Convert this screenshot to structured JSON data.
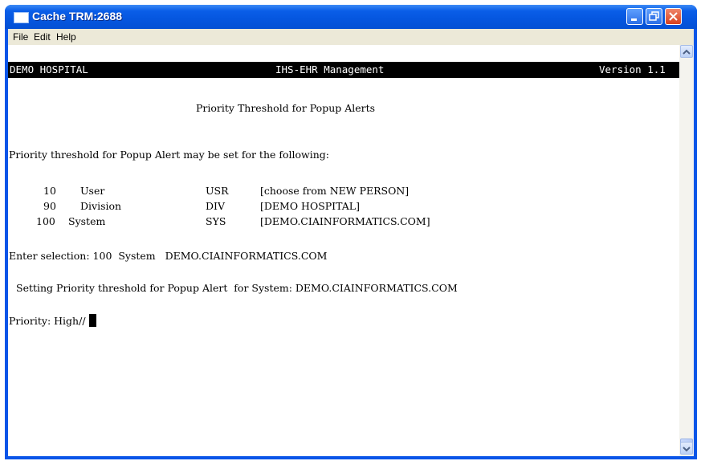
{
  "window": {
    "title": "Cache TRM:2688"
  },
  "menu": [
    "File",
    "Edit",
    "Help"
  ],
  "status_bar": {
    "left": "DEMO HOSPITAL",
    "center": "IHS-EHR Management",
    "right": "Version 1.1"
  },
  "screen": {
    "heading": "Priority Threshold for Popup Alerts",
    "intro": "Priority threshold for Popup Alert may be set for the following:",
    "options": [
      {
        "num": "10",
        "name": "User",
        "code": "USR",
        "desc": "[choose from NEW PERSON]"
      },
      {
        "num": "90",
        "name": "Division",
        "code": "DIV",
        "desc": "[DEMO HOSPITAL]"
      },
      {
        "num": "100",
        "name": "System",
        "code": "SYS",
        "desc": "[DEMO.CIAINFORMATICS.COM]"
      }
    ],
    "selection_line": "Enter selection: 100  System   DEMO.CIAINFORMATICS.COM",
    "setting_line": "Setting Priority threshold for Popup Alert  for System: DEMO.CIAINFORMATICS.COM",
    "prompt": "Priority: High// "
  }
}
